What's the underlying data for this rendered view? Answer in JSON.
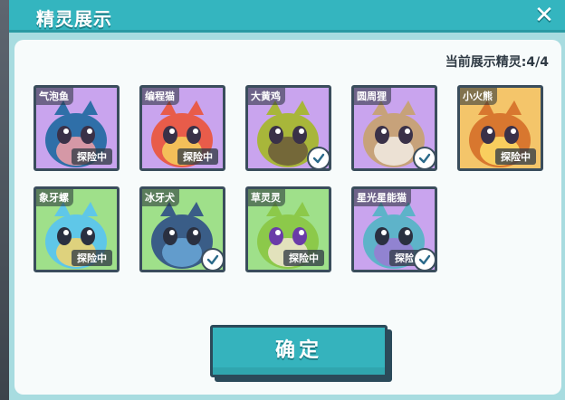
{
  "dialog": {
    "title": "精灵展示",
    "count_label": "当前展示精灵:4/4",
    "confirm_label": "确定",
    "close_icon": "close-icon"
  },
  "sprites": [
    {
      "name": "气泡鱼",
      "status": "探险中",
      "selected": false,
      "bg": "#c9a4ee",
      "icon": "bubble-fish-portrait"
    },
    {
      "name": "编程猫",
      "status": "探险中",
      "selected": false,
      "bg": "#c9a4ee",
      "icon": "coding-cat-portrait"
    },
    {
      "name": "大黄鸡",
      "status": "",
      "selected": true,
      "bg": "#c9a4ee",
      "icon": "yellow-chick-portrait"
    },
    {
      "name": "圆周狸",
      "status": "",
      "selected": true,
      "bg": "#c9a4ee",
      "icon": "raccoon-portrait"
    },
    {
      "name": "小火熊",
      "status": "探险中",
      "selected": false,
      "bg": "#f4c56a",
      "icon": "fire-bear-portrait"
    },
    {
      "name": "象牙螺",
      "status": "探险中",
      "selected": false,
      "bg": "#9fe08a",
      "icon": "ivory-snail-portrait"
    },
    {
      "name": "冰牙犬",
      "status": "",
      "selected": true,
      "bg": "#9fe08a",
      "icon": "ice-dog-portrait"
    },
    {
      "name": "草灵灵",
      "status": "探险中",
      "selected": false,
      "bg": "#9fe08a",
      "icon": "grass-sprite-portrait"
    },
    {
      "name": "星光星能猫",
      "status": "探险中",
      "selected": true,
      "bg": "#c9a4ee",
      "icon": "star-cat-portrait"
    }
  ]
}
